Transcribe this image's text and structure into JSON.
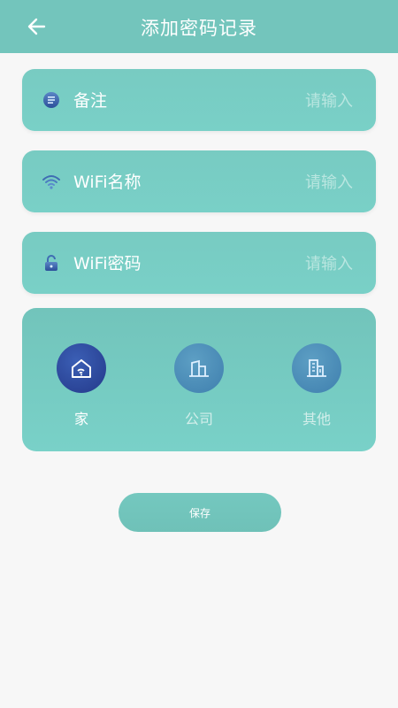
{
  "header": {
    "title": "添加密码记录",
    "back_icon": "arrow-left-icon"
  },
  "fields": [
    {
      "label": "备注",
      "placeholder": "请输入",
      "icon": "note-icon"
    },
    {
      "label": "WiFi名称",
      "placeholder": "请输入",
      "icon": "wifi-icon"
    },
    {
      "label": "WiFi密码",
      "placeholder": "请输入",
      "icon": "lock-icon"
    }
  ],
  "types": [
    {
      "label": "家",
      "icon": "home-wifi-icon",
      "selected": true
    },
    {
      "label": "公司",
      "icon": "office-building-icon",
      "selected": false
    },
    {
      "label": "其他",
      "icon": "other-building-icon",
      "selected": false
    }
  ],
  "save_label": "保存",
  "colors": {
    "primary": "#73c5bc",
    "selected_circle": "#2e4a9c",
    "unselected_circle": "#4f8fb5",
    "unselected_text": "#d2eeea"
  }
}
